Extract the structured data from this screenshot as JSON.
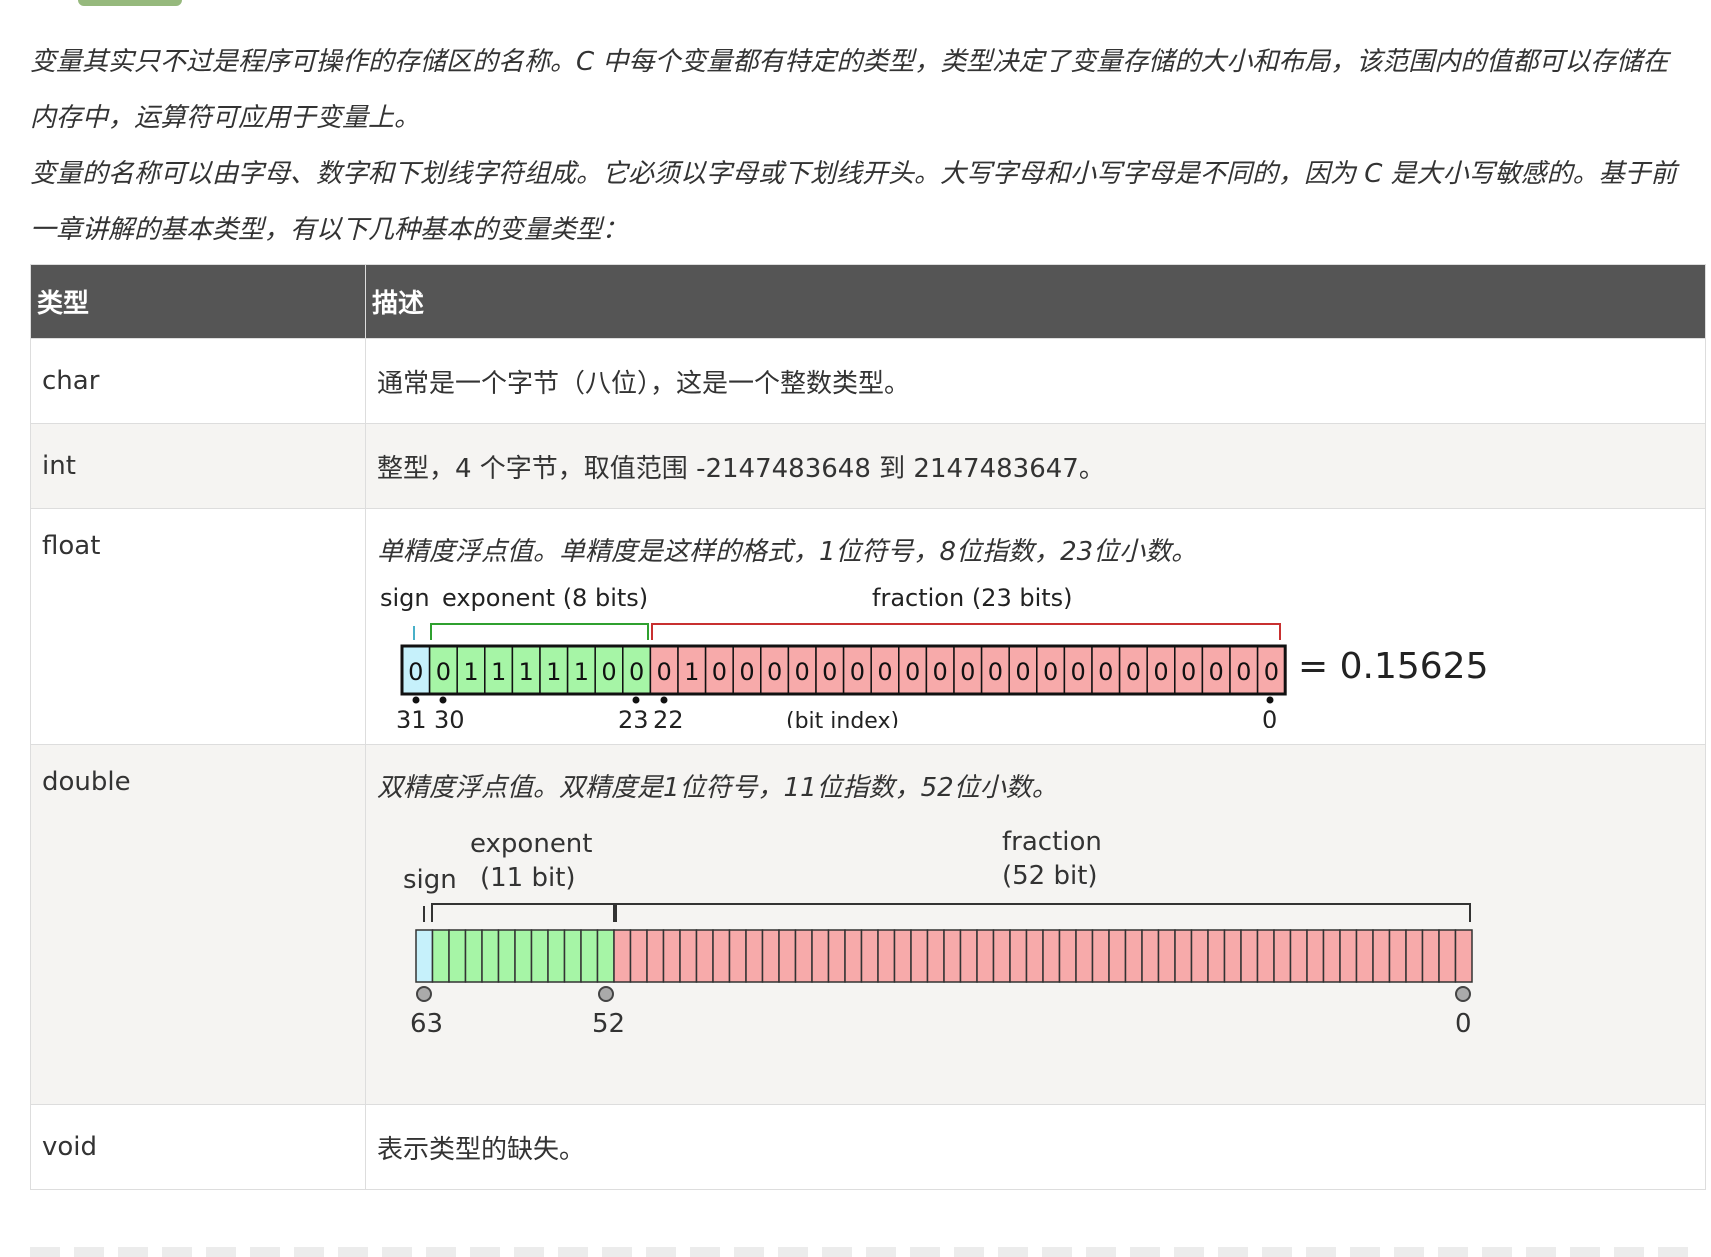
{
  "intro": {
    "paragraph1": "变量其实只不过是程序可操作的存储区的名称。C 中每个变量都有特定的类型，类型决定了变量存储的大小和布局，该范围内的值都可以存储在内存中，运算符可应用于变量上。",
    "paragraph2": "变量的名称可以由字母、数字和下划线字符组成。它必须以字母或下划线开头。大写字母和小写字母是不同的，因为 C 是大小写敏感的。基于前一章讲解的基本类型，有以下几种基本的变量类型："
  },
  "table": {
    "headers": [
      "类型",
      "描述"
    ],
    "rows": [
      {
        "type": "char",
        "desc": "通常是一个字节（八位），这是一个整数类型。"
      },
      {
        "type": "int",
        "desc": "整型，4 个字节，取值范围 -2147483648 到 2147483647。"
      },
      {
        "type": "float",
        "desc": "单精度浮点值。单精度是这样的格式，1位符号，8位指数，23位小数。"
      },
      {
        "type": "double",
        "desc": "双精度浮点值。双精度是1位符号，11位指数，52位小数。"
      },
      {
        "type": "void",
        "desc": "表示类型的缺失。"
      }
    ]
  },
  "float_diagram": {
    "label_sign": "sign",
    "label_exponent": "exponent (8 bits)",
    "label_fraction": "fraction (23 bits)",
    "bits": "00111110001000000000000000000000",
    "result": "= 0.15625",
    "index_31": "31",
    "index_30": "30",
    "index_23": "23",
    "index_22": "22",
    "index_label": "(bit index)",
    "index_0": "0",
    "colors": {
      "sign": "#c6f1fb",
      "exponent": "#a6f5a6",
      "fraction": "#f7aaaa"
    }
  },
  "double_diagram": {
    "label_sign": "sign",
    "label_exponent_1": "exponent",
    "label_exponent_2": "(11 bit)",
    "label_fraction_1": "fraction",
    "label_fraction_2": "(52 bit)",
    "index_63": "63",
    "index_52": "52",
    "index_0": "0",
    "total_bits": 64,
    "exponent_bits": 11,
    "colors": {
      "sign": "#c6f1fb",
      "exponent": "#a6f5a6",
      "fraction": "#f7aaaa"
    }
  }
}
